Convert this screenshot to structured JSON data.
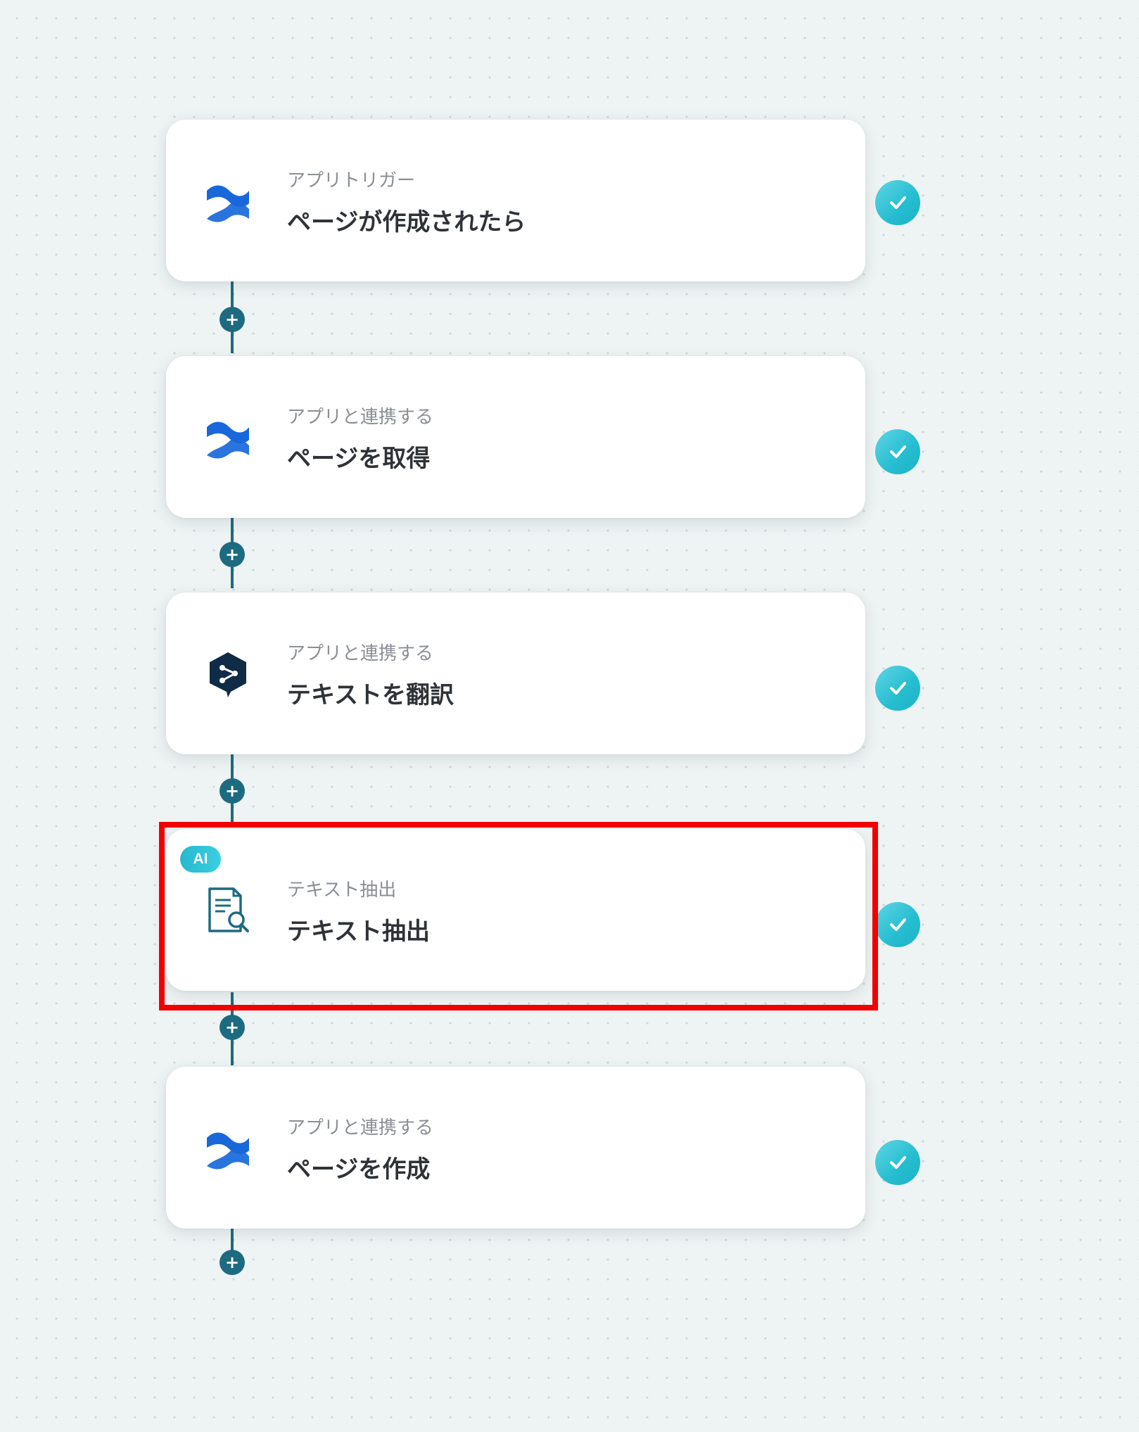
{
  "flow": {
    "steps": [
      {
        "kind": "confluence",
        "subtitle": "アプリトリガー",
        "title": "ページが作成されたら",
        "status": "done"
      },
      {
        "kind": "confluence",
        "subtitle": "アプリと連携する",
        "title": "ページを取得",
        "status": "done"
      },
      {
        "kind": "deepl",
        "subtitle": "アプリと連携する",
        "title": "テキストを翻訳",
        "status": "done"
      },
      {
        "kind": "ai-extract",
        "badge": "AI",
        "subtitle": "テキスト抽出",
        "title": "テキスト抽出",
        "status": "done",
        "highlighted": true
      },
      {
        "kind": "confluence",
        "subtitle": "アプリと連携する",
        "title": "ページを作成",
        "status": "done"
      }
    ],
    "add_step_symbol": "+"
  },
  "colors": {
    "background": "#eef3f3",
    "connector": "#1d6b80",
    "check": "#25bdd0",
    "confluence_blue": "#1868db",
    "deepl_navy": "#0f2b46",
    "ai_badge": "#2fc4d8",
    "highlight_border": "#f20000"
  },
  "icons": {
    "confluence": "confluence-icon",
    "deepl": "deepl-icon",
    "ai-extract": "document-search-icon",
    "check": "check-icon",
    "add": "plus-icon"
  }
}
